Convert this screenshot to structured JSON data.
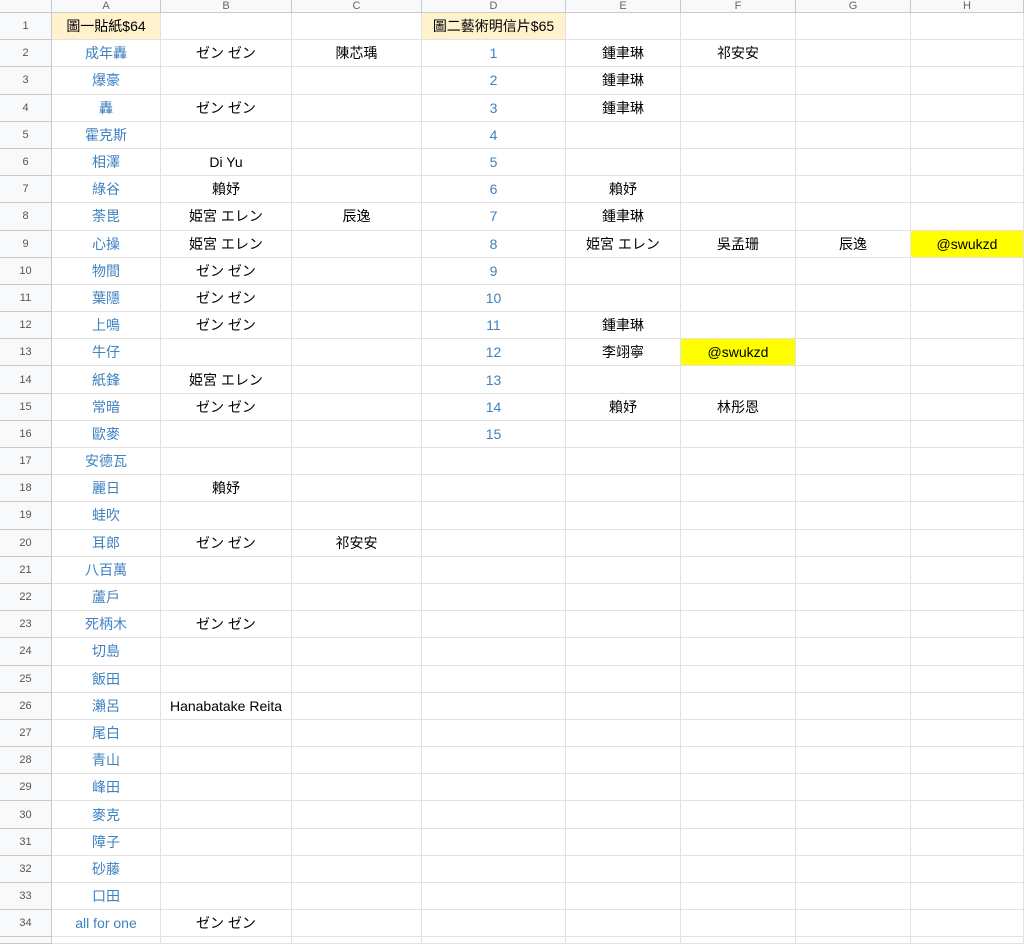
{
  "columns": [
    "A",
    "B",
    "C",
    "D",
    "E",
    "F",
    "G",
    "H"
  ],
  "rows": [
    {
      "num": "1",
      "A": "圖一貼紙$64",
      "B": "",
      "C": "",
      "D": "圖二藝術明信片$65",
      "E": "",
      "F": "",
      "G": "",
      "H": ""
    },
    {
      "num": "2",
      "A": "成年轟",
      "B": "ゼン ゼン",
      "C": "陳芯瑀",
      "D": "1",
      "E": "鍾聿琳",
      "F": "祁安安",
      "G": "",
      "H": ""
    },
    {
      "num": "3",
      "A": "爆豪",
      "B": "",
      "C": "",
      "D": "2",
      "E": "鍾聿琳",
      "F": "",
      "G": "",
      "H": ""
    },
    {
      "num": "4",
      "A": "轟",
      "B": "ゼン ゼン",
      "C": "",
      "D": "3",
      "E": "鍾聿琳",
      "F": "",
      "G": "",
      "H": ""
    },
    {
      "num": "5",
      "A": "霍克斯",
      "B": "",
      "C": "",
      "D": "4",
      "E": "",
      "F": "",
      "G": "",
      "H": ""
    },
    {
      "num": "6",
      "A": "相澤",
      "B": "Di Yu",
      "C": "",
      "D": "5",
      "E": "",
      "F": "",
      "G": "",
      "H": ""
    },
    {
      "num": "7",
      "A": "綠谷",
      "B": "賴妤",
      "C": "",
      "D": "6",
      "E": "賴妤",
      "F": "",
      "G": "",
      "H": ""
    },
    {
      "num": "8",
      "A": "荼毘",
      "B": "姫宮 エレン",
      "C": "辰逸",
      "D": "7",
      "E": "鍾聿琳",
      "F": "",
      "G": "",
      "H": ""
    },
    {
      "num": "9",
      "A": "心操",
      "B": "姫宮 エレン",
      "C": "",
      "D": "8",
      "E": "姫宮 エレン",
      "F": "吳孟珊",
      "G": "辰逸",
      "H": "@swukzd"
    },
    {
      "num": "10",
      "A": "物間",
      "B": "ゼン ゼン",
      "C": "",
      "D": "9",
      "E": "",
      "F": "",
      "G": "",
      "H": ""
    },
    {
      "num": "11",
      "A": "葉隱",
      "B": "ゼン ゼン",
      "C": "",
      "D": "10",
      "E": "",
      "F": "",
      "G": "",
      "H": ""
    },
    {
      "num": "12",
      "A": "上鳴",
      "B": "ゼン ゼン",
      "C": "",
      "D": "11",
      "E": "鍾聿琳",
      "F": "",
      "G": "",
      "H": ""
    },
    {
      "num": "13",
      "A": "牛仔",
      "B": "",
      "C": "",
      "D": "12",
      "E": "李翊寧",
      "F": "@swukzd",
      "G": "",
      "H": ""
    },
    {
      "num": "14",
      "A": "紙鋒",
      "B": "姫宮 エレン",
      "C": "",
      "D": "13",
      "E": "",
      "F": "",
      "G": "",
      "H": ""
    },
    {
      "num": "15",
      "A": "常暗",
      "B": "ゼン ゼン",
      "C": "",
      "D": "14",
      "E": "賴妤",
      "F": "林彤恩",
      "G": "",
      "H": ""
    },
    {
      "num": "16",
      "A": "歐麥",
      "B": "",
      "C": "",
      "D": "15",
      "E": "",
      "F": "",
      "G": "",
      "H": ""
    },
    {
      "num": "17",
      "A": "安德瓦",
      "B": "",
      "C": "",
      "D": "",
      "E": "",
      "F": "",
      "G": "",
      "H": ""
    },
    {
      "num": "18",
      "A": "麗日",
      "B": "賴妤",
      "C": "",
      "D": "",
      "E": "",
      "F": "",
      "G": "",
      "H": ""
    },
    {
      "num": "19",
      "A": "蛙吹",
      "B": "",
      "C": "",
      "D": "",
      "E": "",
      "F": "",
      "G": "",
      "H": ""
    },
    {
      "num": "20",
      "A": "耳郎",
      "B": "ゼン ゼン",
      "C": "祁安安",
      "D": "",
      "E": "",
      "F": "",
      "G": "",
      "H": ""
    },
    {
      "num": "21",
      "A": "八百萬",
      "B": "",
      "C": "",
      "D": "",
      "E": "",
      "F": "",
      "G": "",
      "H": ""
    },
    {
      "num": "22",
      "A": "蘆戶",
      "B": "",
      "C": "",
      "D": "",
      "E": "",
      "F": "",
      "G": "",
      "H": ""
    },
    {
      "num": "23",
      "A": "死柄木",
      "B": "ゼン ゼン",
      "C": "",
      "D": "",
      "E": "",
      "F": "",
      "G": "",
      "H": ""
    },
    {
      "num": "24",
      "A": "切島",
      "B": "",
      "C": "",
      "D": "",
      "E": "",
      "F": "",
      "G": "",
      "H": ""
    },
    {
      "num": "25",
      "A": "飯田",
      "B": "",
      "C": "",
      "D": "",
      "E": "",
      "F": "",
      "G": "",
      "H": ""
    },
    {
      "num": "26",
      "A": "瀨呂",
      "B": "Hanabatake Reita",
      "C": "",
      "D": "",
      "E": "",
      "F": "",
      "G": "",
      "H": ""
    },
    {
      "num": "27",
      "A": "尾白",
      "B": "",
      "C": "",
      "D": "",
      "E": "",
      "F": "",
      "G": "",
      "H": ""
    },
    {
      "num": "28",
      "A": "青山",
      "B": "",
      "C": "",
      "D": "",
      "E": "",
      "F": "",
      "G": "",
      "H": ""
    },
    {
      "num": "29",
      "A": "峰田",
      "B": "",
      "C": "",
      "D": "",
      "E": "",
      "F": "",
      "G": "",
      "H": ""
    },
    {
      "num": "30",
      "A": "麥克",
      "B": "",
      "C": "",
      "D": "",
      "E": "",
      "F": "",
      "G": "",
      "H": ""
    },
    {
      "num": "31",
      "A": "障子",
      "B": "",
      "C": "",
      "D": "",
      "E": "",
      "F": "",
      "G": "",
      "H": ""
    },
    {
      "num": "32",
      "A": "砂藤",
      "B": "",
      "C": "",
      "D": "",
      "E": "",
      "F": "",
      "G": "",
      "H": ""
    },
    {
      "num": "33",
      "A": "口田",
      "B": "",
      "C": "",
      "D": "",
      "E": "",
      "F": "",
      "G": "",
      "H": ""
    },
    {
      "num": "34",
      "A": "all for one",
      "B": "ゼン ゼン",
      "C": "",
      "D": "",
      "E": "",
      "F": "",
      "G": "",
      "H": ""
    }
  ],
  "styles": {
    "header_fill": "#fff2cc",
    "highlight_fill": "#ffff00",
    "link_text": "#3f82c0"
  }
}
